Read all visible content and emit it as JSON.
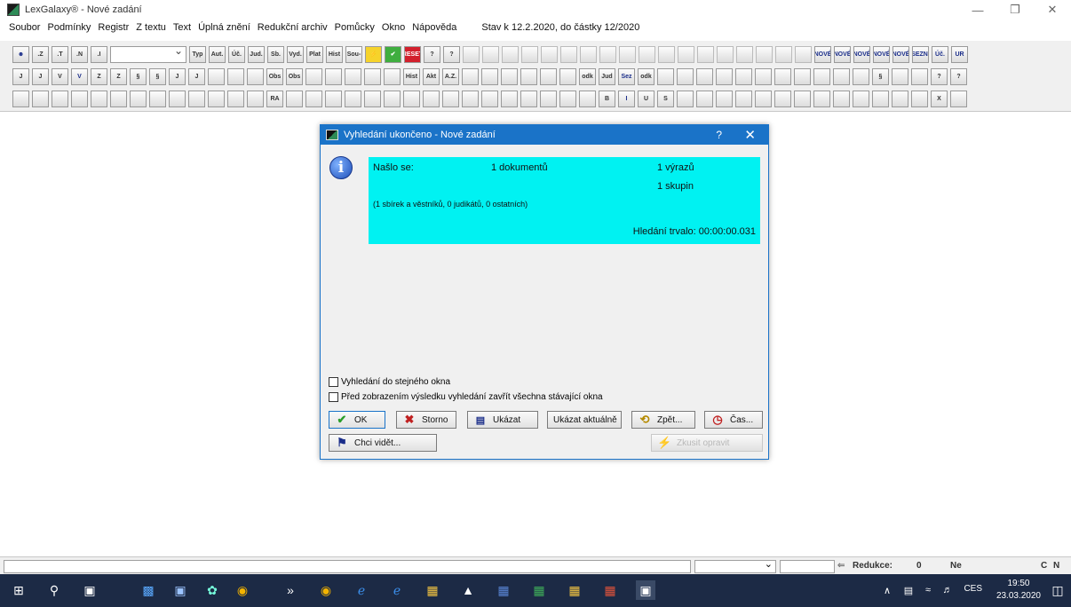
{
  "window": {
    "title": "LexGalaxy® - Nové zadání",
    "minimize": "—",
    "maximize": "❐",
    "close": "✕"
  },
  "menu": {
    "items": [
      "Soubor",
      "Podmínky",
      "Registr",
      "Z textu",
      "Text",
      "Úplná znění",
      "Redukční archiv",
      "Pomůcky",
      "Okno",
      "Nápověda"
    ],
    "status": "Stav k 12.2.2020, do částky 12/2020"
  },
  "toolbar": {
    "row1_left": [
      ".Z",
      ".T",
      ".N",
      ".I"
    ],
    "row1_right": [
      "Typ",
      "Aut.",
      "Úč.",
      "Jud.",
      "Sb.",
      "Vyd.",
      "Plat",
      "Hist",
      "Sou-",
      "?",
      "?",
      "RESET",
      "?",
      "?"
    ],
    "row1_more": [
      "",
      "",
      "",
      "",
      "",
      "",
      "",
      "",
      "",
      "",
      "",
      "",
      "",
      "",
      "",
      "",
      "",
      "",
      "NOVÉ",
      "NOVÉ",
      "NOVÉ",
      "NOVÉ",
      "NOVÉ",
      "SEZN.",
      "Úč.",
      "UR"
    ],
    "row2": [
      "J",
      "J",
      "V",
      "V",
      "Z",
      "Z",
      "§",
      "§",
      "J",
      "J",
      "",
      "",
      "",
      "Obs",
      "Obs",
      "",
      "",
      "",
      "",
      "",
      "Hist",
      "Akt",
      "A.Z.",
      "",
      "",
      "",
      "",
      "",
      "",
      "odk",
      "Jud",
      "Sez",
      "odk",
      "",
      "",
      "",
      "",
      "",
      "",
      "",
      "",
      "",
      "",
      "",
      "§",
      "",
      "",
      "?",
      "?"
    ],
    "row3": [
      "",
      "",
      "",
      "",
      "",
      "",
      "",
      "",
      "",
      "",
      "",
      "",
      "",
      "RA",
      "",
      "",
      "",
      "",
      "",
      "",
      "",
      "",
      "",
      "",
      "",
      "",
      "",
      "",
      "",
      "",
      "B",
      "I",
      "U",
      "S",
      "",
      "",
      "",
      "",
      "",
      "",
      "",
      "",
      "",
      "",
      "",
      "",
      "",
      "X",
      ""
    ]
  },
  "dialog": {
    "title": "Vyhledání ukončeno - Nové zadání",
    "help": "?",
    "close": "✕",
    "info_glyph": "i",
    "found_label": "Našlo se:",
    "documents": "1 dokumentů",
    "expressions": "1 výrazů",
    "groups": "1 skupin",
    "detail": "(1 sbírek a věstníků, 0 judikátů, 0 ostatních)",
    "duration": "Hledání trvalo: 00:00:00.031",
    "checkbox1": "Vyhledání do stejného okna",
    "checkbox2": "Před zobrazením výsledku vyhledání zavřít všechna stávající okna",
    "buttons": {
      "ok": "OK",
      "cancel": "Storno",
      "show": "Ukázat",
      "show_current": "Ukázat aktuálně",
      "back": "Zpět...",
      "time": "Čas...",
      "want_see": "Chci vidět...",
      "retry": "Zkusit opravit"
    }
  },
  "statusbar": {
    "reduction_label": "Redukce:",
    "reduction_value": "0",
    "ne": "Ne",
    "c": "C",
    "n": "N"
  },
  "taskbar": {
    "lang": "CES",
    "time": "19:50",
    "date": "23.03.2020"
  },
  "colors": {
    "result_box": "#00f2f2",
    "dialog_title": "#1a73c8",
    "taskbar": "#1c2a45"
  }
}
